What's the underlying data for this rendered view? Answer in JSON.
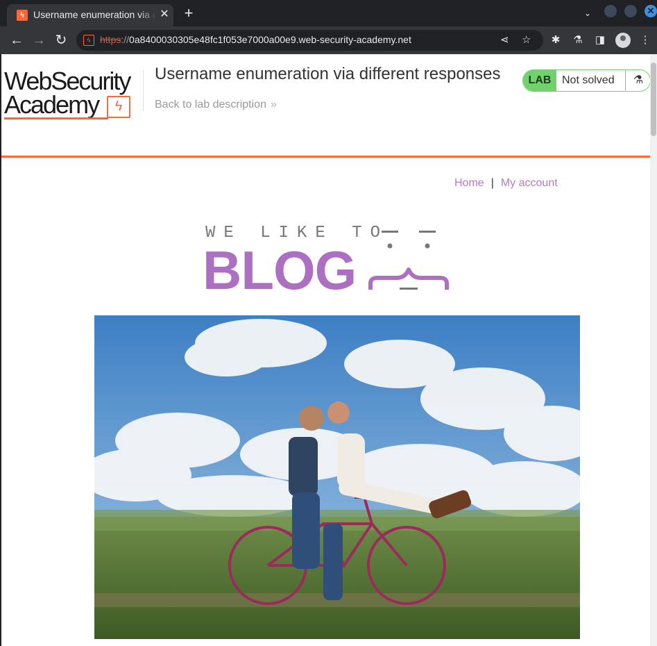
{
  "browser": {
    "tab_title": "Username enumeration via different responses",
    "tab_close": "✕",
    "new_tab": "+",
    "url_scheme": "https",
    "url_sep": "://",
    "url_host": "0a8400030305e48fc1f053e7000a00e9.web-security-academy.net"
  },
  "academy": {
    "logo_line1": "WebSecurity",
    "logo_line2": "Academy",
    "lab_title": "Username enumeration via different responses",
    "back_link": "Back to lab description",
    "lab_badge": "LAB",
    "lab_status": "Not solved"
  },
  "nav": {
    "home": "Home",
    "separator": "|",
    "account": "My account"
  },
  "blog_logo": {
    "tagline": "WE LIKE TO",
    "word": "BLOG"
  },
  "hero_image": {
    "subject": "couple-on-bicycle-photo"
  },
  "colors": {
    "accent_orange": "#ff6633",
    "lab_green": "#70d16d",
    "blog_purple": "#ad6fc1",
    "link_purple": "#b27bc6"
  }
}
